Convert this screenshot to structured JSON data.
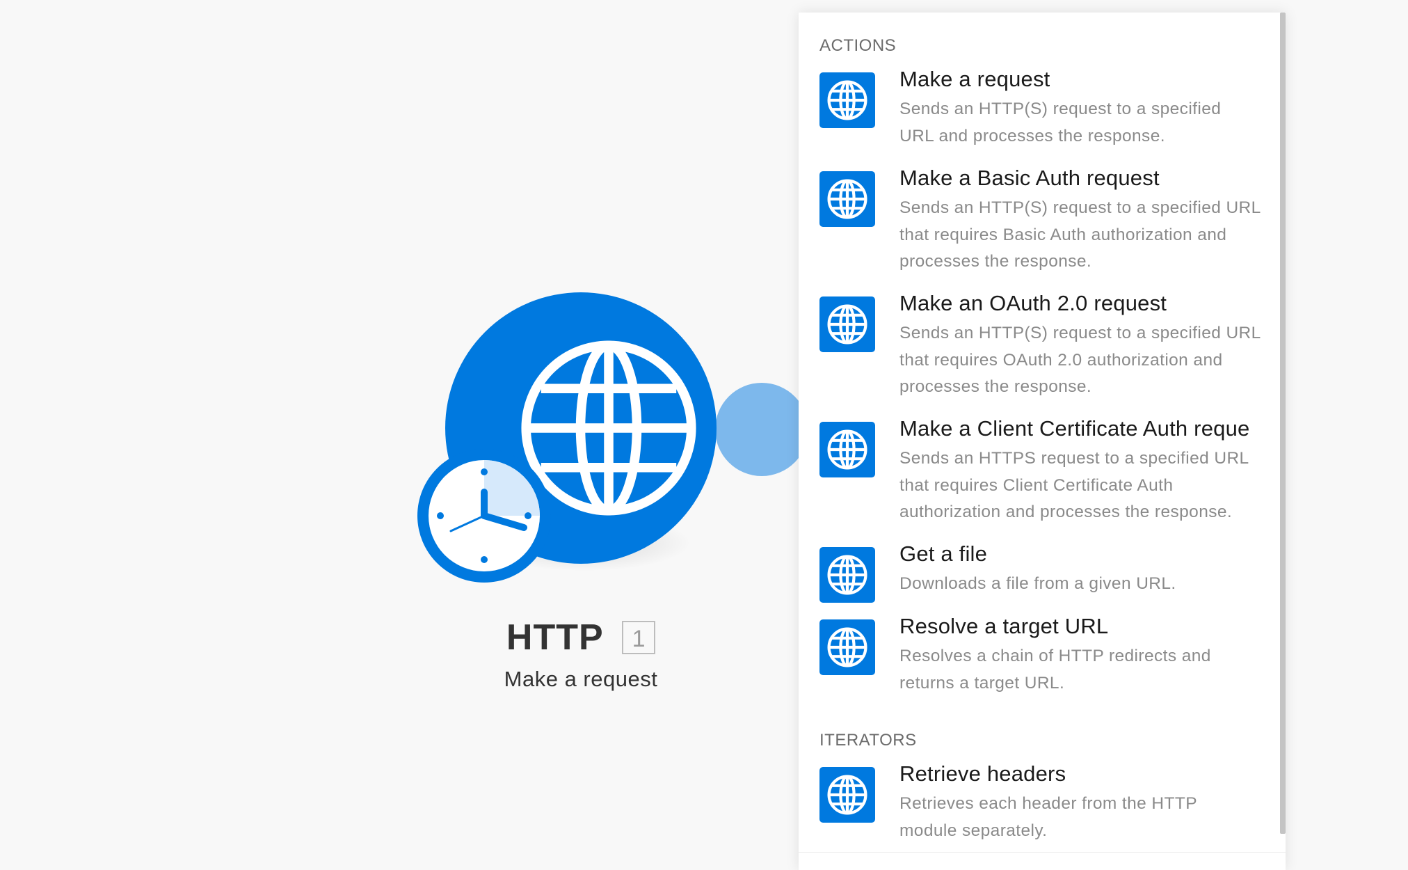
{
  "module": {
    "title": "HTTP",
    "id": "1",
    "subtitle": "Make a request",
    "icon": "globe-icon",
    "badge_icon": "clock-icon"
  },
  "colors": {
    "brand": "#0079df",
    "connector": "#7db8ec",
    "background": "#f8f8f8",
    "panel": "#ffffff"
  },
  "panel": {
    "sections": [
      {
        "heading": "ACTIONS",
        "items": [
          {
            "title": "Make a request",
            "description": "Sends an HTTP(S) request to a specified URL and processes the response."
          },
          {
            "title": "Make a Basic Auth request",
            "description": "Sends an HTTP(S) request to a specified URL that requires Basic Auth authorization and processes the response."
          },
          {
            "title": "Make an OAuth 2.0 request",
            "description": "Sends an HTTP(S) request to a specified URL that requires OAuth 2.0 authorization and processes the response."
          },
          {
            "title": "Make a Client Certificate Auth reque",
            "description": "Sends an HTTPS request to a specified URL that requires Client Certificate Auth authorization and processes the response."
          },
          {
            "title": "Get a file",
            "description": "Downloads a file from a given URL."
          },
          {
            "title": "Resolve a target URL",
            "description": "Resolves a chain of HTTP redirects and returns a target URL."
          }
        ]
      },
      {
        "heading": "ITERATORS",
        "items": [
          {
            "title": "Retrieve headers",
            "description": "Retrieves each header from the HTTP module separately."
          }
        ]
      }
    ]
  }
}
